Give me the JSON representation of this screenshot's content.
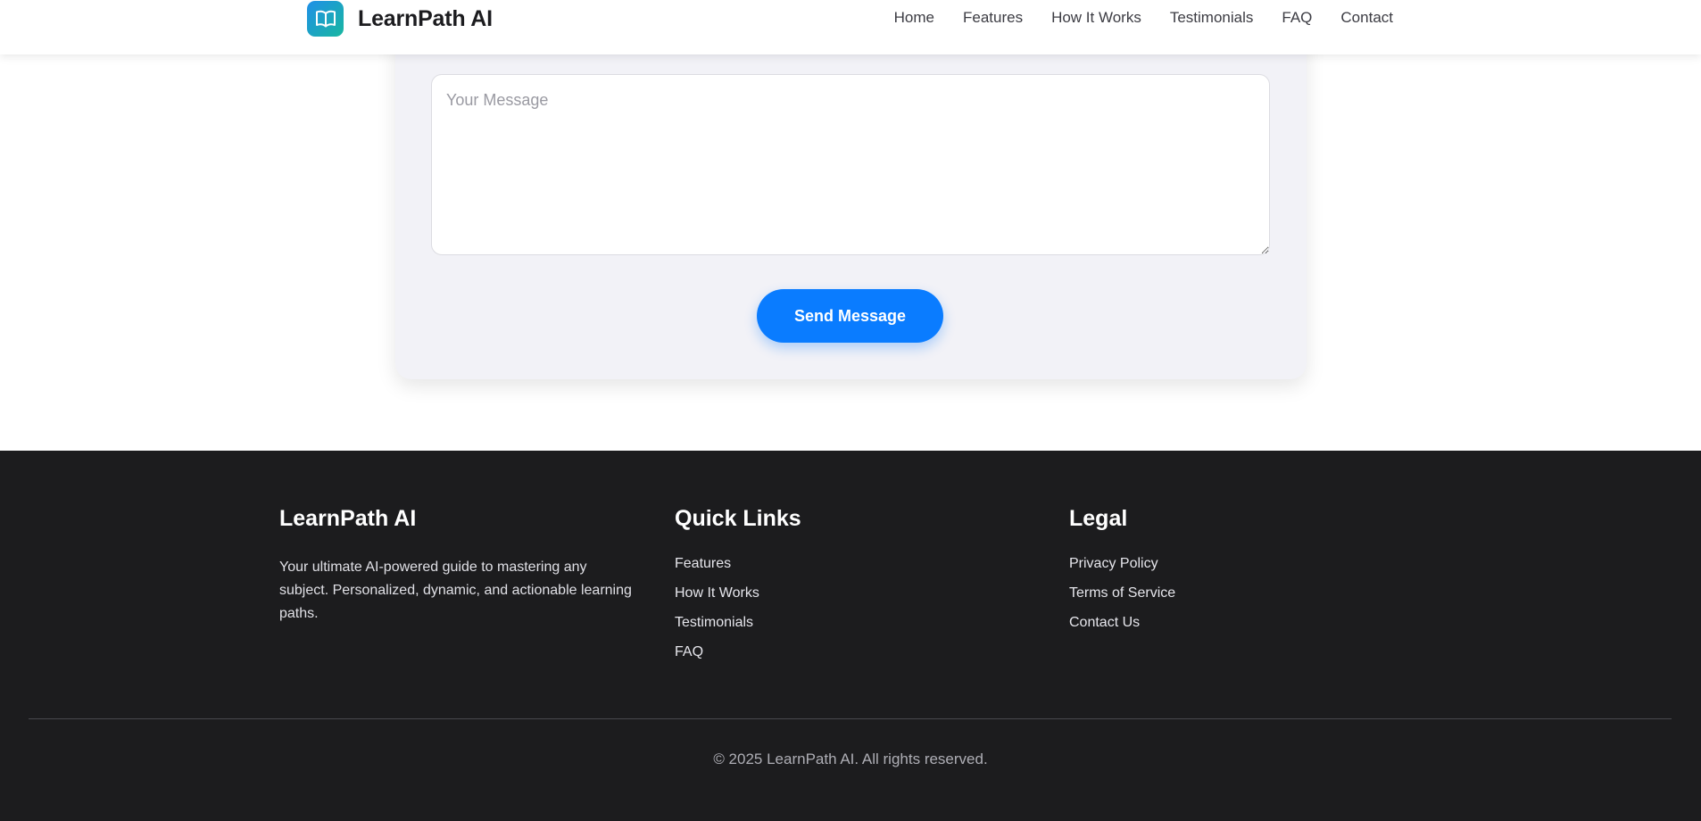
{
  "header": {
    "brand": "LearnPath AI",
    "nav": [
      {
        "label": "Home"
      },
      {
        "label": "Features"
      },
      {
        "label": "How It Works"
      },
      {
        "label": "Testimonials"
      },
      {
        "label": "FAQ"
      },
      {
        "label": "Contact"
      }
    ]
  },
  "contact_form": {
    "message_placeholder": "Your Message",
    "message_value": "",
    "submit_label": "Send Message"
  },
  "footer": {
    "about": {
      "title": "LearnPath AI",
      "description": "Your ultimate AI-powered guide to mastering any subject. Personalized, dynamic, and actionable learning paths."
    },
    "quick_links": {
      "title": "Quick Links",
      "items": [
        {
          "label": "Features"
        },
        {
          "label": "How It Works"
        },
        {
          "label": "Testimonials"
        },
        {
          "label": "FAQ"
        }
      ]
    },
    "legal": {
      "title": "Legal",
      "items": [
        {
          "label": "Privacy Policy"
        },
        {
          "label": "Terms of Service"
        },
        {
          "label": "Contact Us"
        }
      ]
    },
    "copyright": "© 2025 LearnPath AI. All rights reserved."
  },
  "colors": {
    "accent": "#0a7cff",
    "footer_bg": "#1c1c1e",
    "form_bg": "#f2f2f7",
    "logo_gradient_start": "#1f8fe8",
    "logo_gradient_end": "#19b7a0"
  },
  "icons": {
    "logo": "open-book-icon"
  }
}
